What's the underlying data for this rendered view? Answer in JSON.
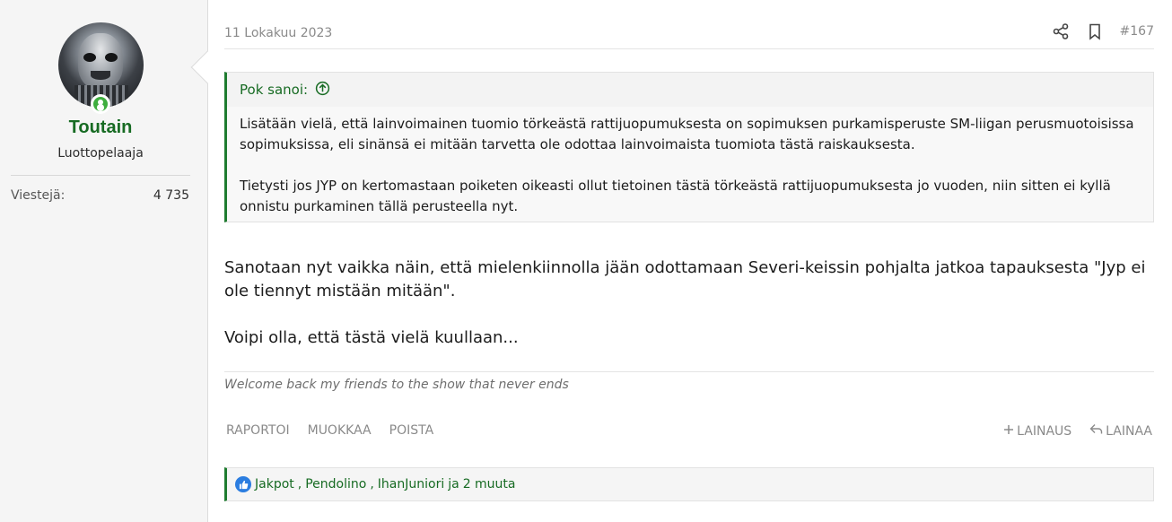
{
  "user": {
    "name": "Toutain",
    "title": "Luottopelaaja",
    "stats": [
      {
        "label": "Viestejä:",
        "value": "4 735"
      }
    ]
  },
  "post": {
    "date": "11 Lokakuu 2023",
    "number": "#167",
    "quote": {
      "author_label": "Pok sanoi:",
      "paragraphs": [
        "Lisätään vielä, että lainvoimainen tuomio törkeästä rattijuopumuksesta on sopimuksen purkamisperuste SM-liigan perusmuotoisissa sopimuksissa, eli sinänsä ei mitään tarvetta ole odottaa lainvoimaista tuomiota tästä raiskauksesta.",
        "Tietysti jos JYP on kertomastaan poiketen oikeasti ollut tietoinen tästä törkeästä rattijuopumuksesta jo vuoden, niin sitten ei kyllä onnistu purkaminen tällä perusteella nyt."
      ]
    },
    "body": [
      "Sanotaan nyt vaikka näin, että mielenkiinnolla jään odottamaan Severi-keissin pohjalta jatkoa tapauksesta \"Jyp ei ole tiennyt mistään mitään\".",
      "Voipi olla, että tästä vielä kuullaan..."
    ],
    "signature": "Welcome back my friends to the show that never ends",
    "actions_left": [
      "RAPORTOI",
      "MUOKKAA",
      "POISTA"
    ],
    "actions_right": {
      "quote_add": "LAINAUS",
      "reply": "LAINAA"
    },
    "reactions": {
      "users": [
        "Jakpot",
        "Pendolino",
        "IhanJuniori"
      ],
      "connector": "ja",
      "others": "2 muuta"
    }
  },
  "icons": {
    "share": "share-icon",
    "bookmark": "bookmark-icon",
    "quote_up": "arrow-up-circle-icon",
    "like": "like-icon",
    "plus": "plus-icon",
    "reply": "reply-icon",
    "online": "online-status-icon"
  },
  "colors": {
    "accent": "#176b23",
    "like": "#2b7de0",
    "muted": "#8a8a8a"
  }
}
